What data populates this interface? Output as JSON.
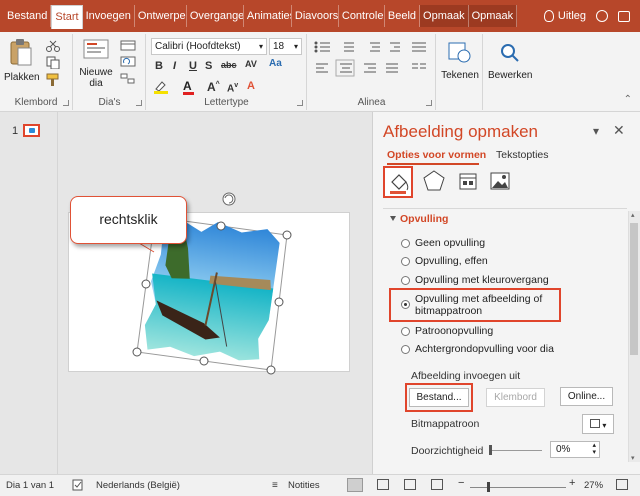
{
  "tabs": [
    "Bestand",
    "Start",
    "Invoegen",
    "Ontwerpen",
    "Overgangen",
    "Animaties",
    "Diavoorstelling",
    "Controleren",
    "Beeld",
    "Opmaak",
    "Opmaak"
  ],
  "tip_label": "Uitleg",
  "ribbon": {
    "clipboard": {
      "paste": "Plakken",
      "group": "Klembord"
    },
    "slides": {
      "new_slide": "Nieuwe dia",
      "group": "Dia's"
    },
    "font": {
      "font_name": "Calibri (Hoofdtekst)",
      "font_size": "18",
      "group": "Lettertype"
    },
    "paragraph": {
      "group": "Alinea"
    },
    "drawing": {
      "label": "Tekenen"
    },
    "editing": {
      "label": "Bewerken"
    }
  },
  "thumbs": {
    "slide_number": "1"
  },
  "editor": {
    "callout_text": "rechtsklik"
  },
  "pane": {
    "title": "Afbeelding opmaken",
    "tab_shape": "Opties voor vormen",
    "tab_text": "Tekstopties",
    "section": "Opvulling",
    "options": [
      {
        "label": "Geen opvulling",
        "selected": false
      },
      {
        "label": "Opvulling, effen",
        "selected": false
      },
      {
        "label": "Opvulling met kleurovergang",
        "selected": false
      },
      {
        "label": "Opvulling met afbeelding of bitmappatroon",
        "selected": true
      },
      {
        "label": "Patroonopvulling",
        "selected": false
      },
      {
        "label": "Achtergrondopvulling voor dia",
        "selected": false
      }
    ],
    "insert_from": "Afbeelding invoegen uit",
    "btn_file": "Bestand...",
    "btn_clipboard": "Klembord",
    "btn_online": "Online...",
    "bitmap_label": "Bitmappatroon",
    "transparency_label": "Doorzichtigheid",
    "transparency_value": "0%"
  },
  "status": {
    "slide_of": "Dia 1 van 1",
    "language": "Nederlands (België)",
    "notes": "Notities",
    "zoom": "27%"
  },
  "colors": {
    "accent": "#b7472a",
    "accent_text": "#d24726",
    "highlight": "#e0452c"
  }
}
